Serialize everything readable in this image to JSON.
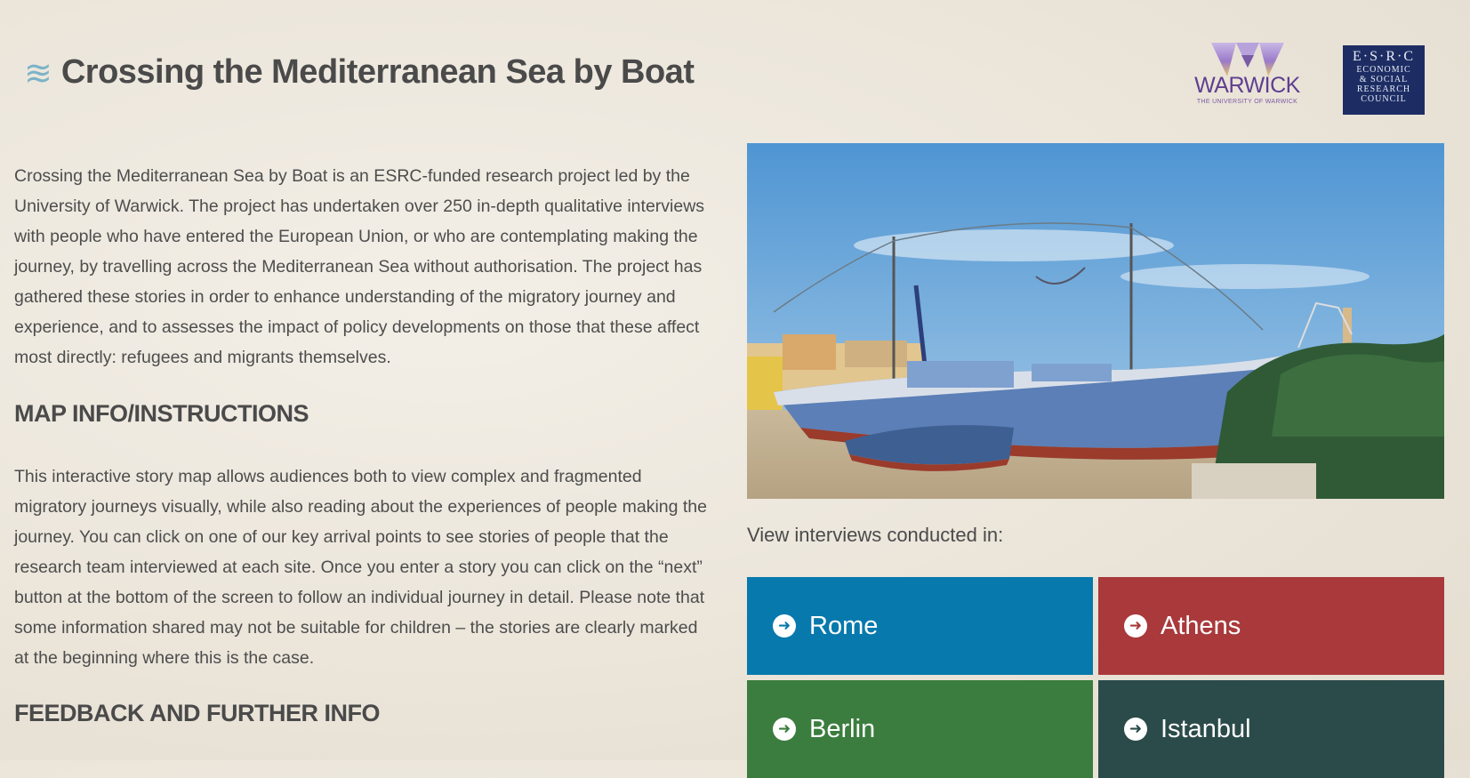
{
  "header": {
    "title": "Crossing the Mediterranean Sea by Boat",
    "title_icon": "waves-icon"
  },
  "logos": {
    "warwick": {
      "name": "WARWICK",
      "subtitle": "THE UNIVERSITY OF WARWICK"
    },
    "esrc": {
      "abbr": "E·S·R·C",
      "lines": [
        "ECONOMIC",
        "& SOCIAL",
        "RESEARCH",
        "COUNCIL"
      ]
    }
  },
  "intro": "Crossing the Mediterranean Sea by Boat is an ESRC-funded research project led by the University of Warwick. The project has undertaken over 250 in-depth qualitative interviews with people who have entered the European Union, or who are contemplating making the journey, by travelling across the Mediterranean Sea without authorisation. The project has gathered these stories in order to enhance understanding of the migratory journey and experience, and to assesses the impact of policy developments on those that these affect most directly: refugees and migrants themselves.",
  "sections": {
    "map_info_heading": "MAP INFO/INSTRUCTIONS",
    "map_info_text": "This interactive story map allows audiences both to view complex and fragmented migratory journeys visually, while also reading about the experiences of people making the journey. You can click on one of our key arrival points to see stories of people that the research team interviewed at each site. Once you enter a story you can click on the “next” button at the bottom of the screen to follow an individual journey in detail. Please note that some information shared may not be suitable for children – the stories are clearly marked at the beginning where this is the case.",
    "feedback_heading": "FEEDBACK AND FURTHER INFO"
  },
  "interviews": {
    "label": "View interviews conducted in:",
    "cities": [
      {
        "name": "Rome",
        "color": "#0779ad",
        "icon": "arrow-right-circle-icon"
      },
      {
        "name": "Athens",
        "color": "#a9393b",
        "icon": "arrow-right-circle-icon"
      },
      {
        "name": "Berlin",
        "color": "#3b7d3e",
        "icon": "arrow-right-circle-icon"
      },
      {
        "name": "Istanbul",
        "color": "#2b4b4a",
        "icon": "arrow-right-circle-icon"
      }
    ]
  },
  "colors": {
    "background": "#ebe5da",
    "text": "#4a4a4a",
    "title_icon": "#7bb3c7",
    "warwick_purple": "#5f3e8f",
    "esrc_navy": "#1d2d64"
  }
}
